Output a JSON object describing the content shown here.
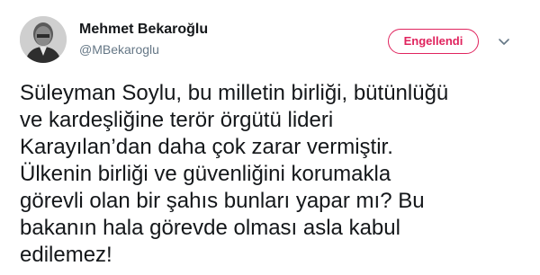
{
  "user": {
    "display_name": "Mehmet Bekaroğlu",
    "handle": "@MBekaroglu"
  },
  "actions": {
    "blocked_label": "Engellendi",
    "menu_icon": "chevron-down-icon"
  },
  "tweet": {
    "text": "Süleyman Soylu, bu milletin birliği, bütünlüğü\nve kardeşliğine terör örgütü lideri\nKarayılan’dan daha çok zarar vermiştir.\nÜlkenin birliği ve güvenliğini korumakla\ngörevli olan bir şahıs bunları yapar mı? Bu\nbakanın hala görevde olması asla kabul\nedilemez!"
  },
  "colors": {
    "blocked_accent": "#e0245e",
    "handle_gray": "#657786",
    "text": "#14171a"
  }
}
